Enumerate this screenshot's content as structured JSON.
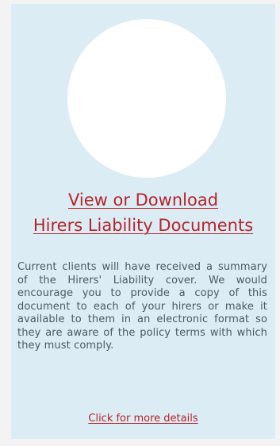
{
  "card": {
    "heading_line1": "View or Download",
    "heading_line2": "Hirers Liability Documents",
    "description": "Current clients will have received a summary of the Hirers' Liability cover. We would encourage you to provide a copy of this document to each of your hirers or make it available to them in an electronic format so they are aware of the policy terms with which they must comply.",
    "more_link": "Click for more details"
  },
  "colors": {
    "card_background": "#dcecf5",
    "accent": "#b4242b",
    "text": "#4b5a63"
  }
}
